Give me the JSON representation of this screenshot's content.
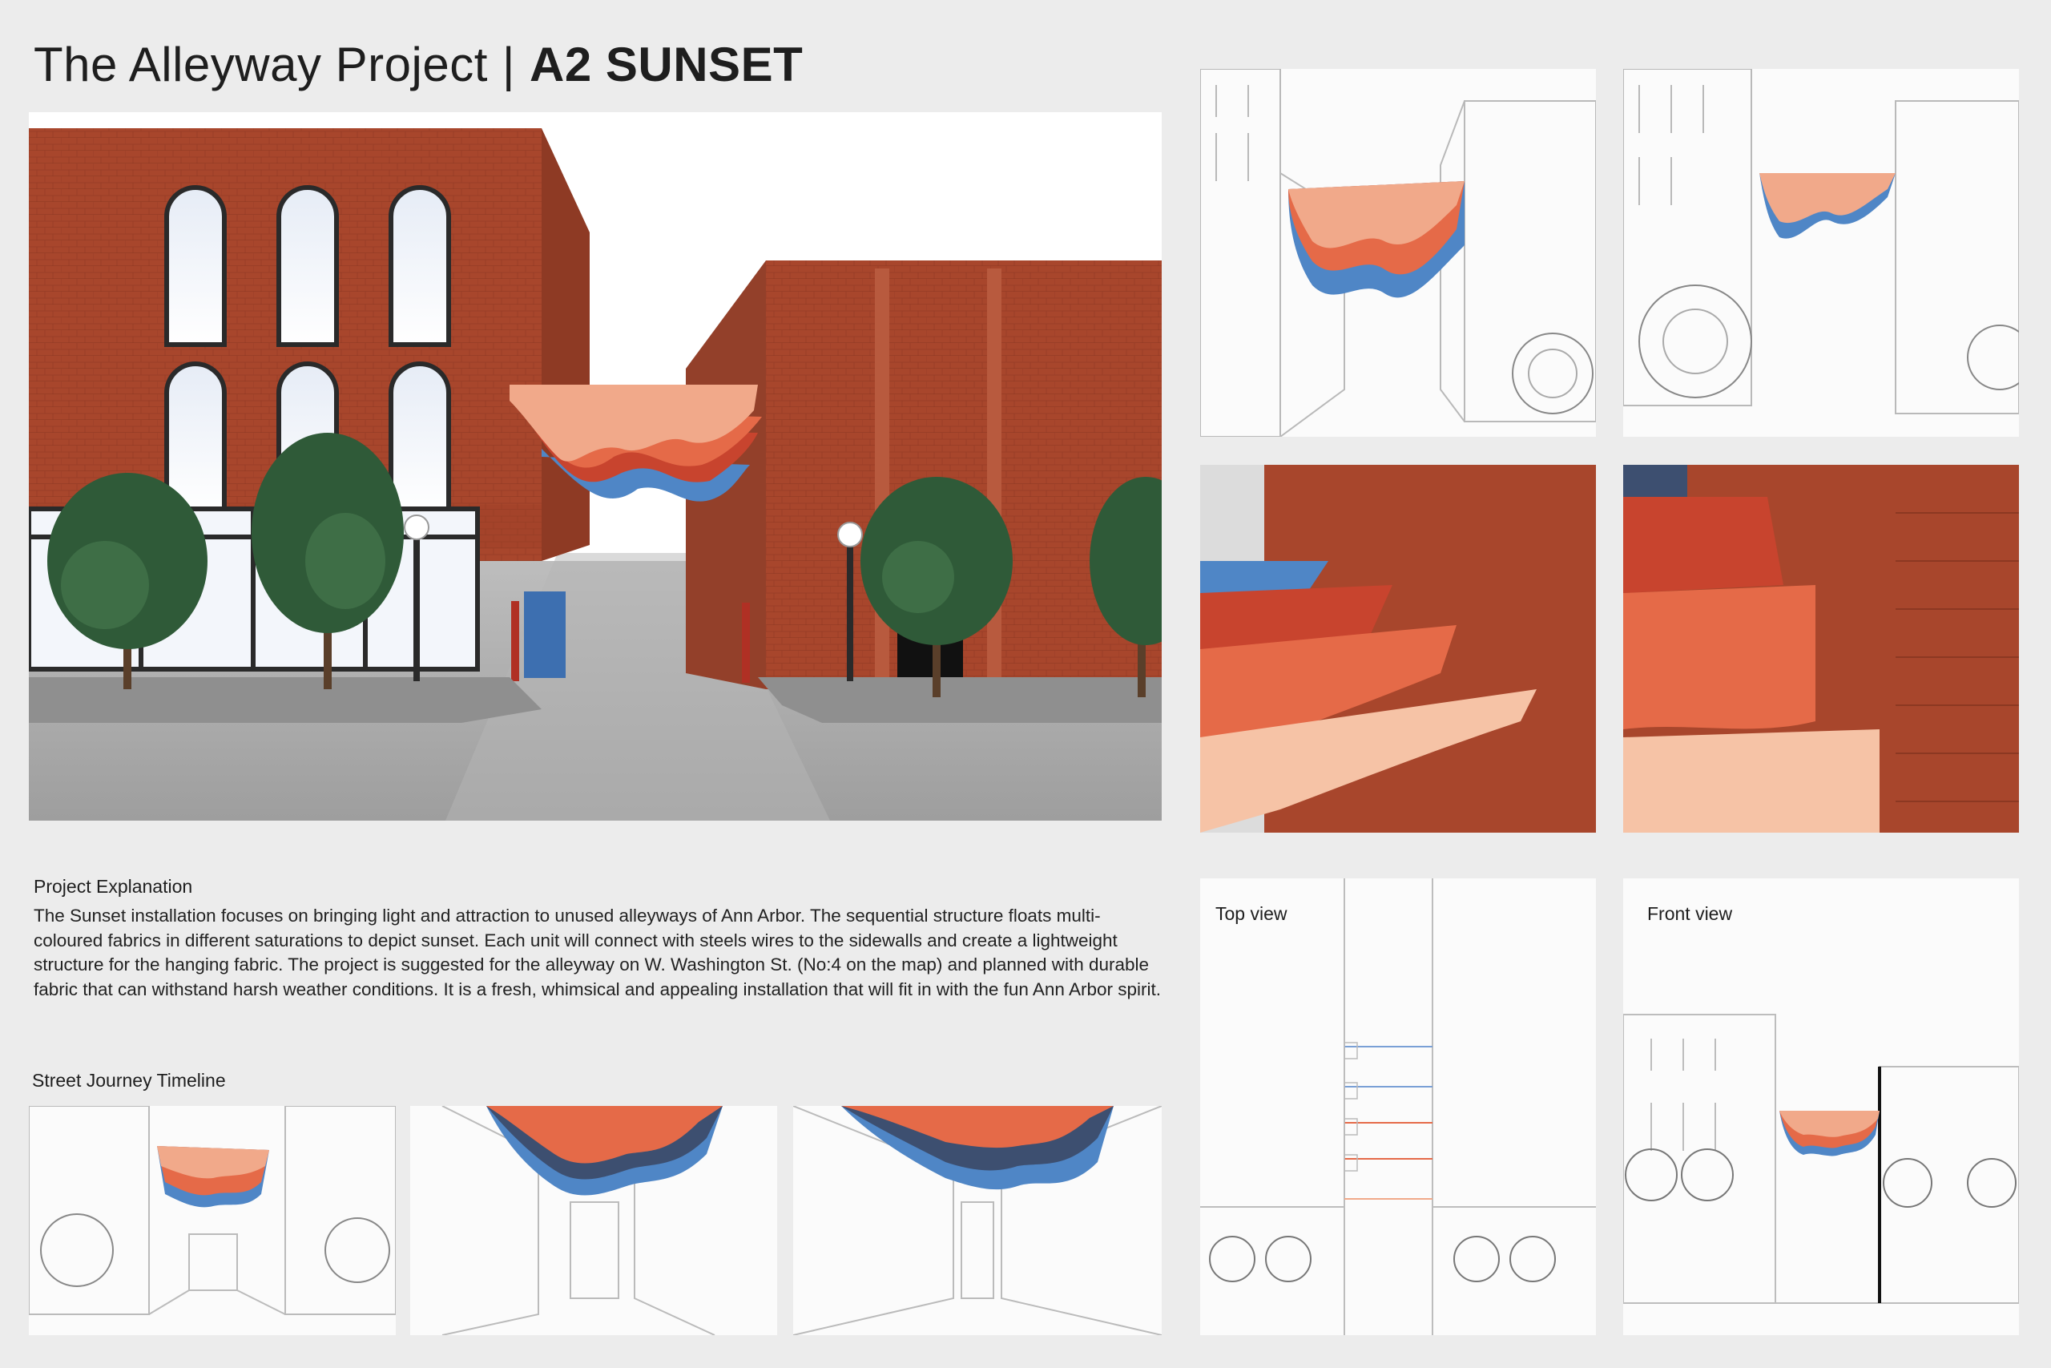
{
  "header": {
    "project": "The Alleyway Project",
    "separator": "|",
    "subtitle": "A2 SUNSET"
  },
  "explanation": {
    "heading": "Project Explanation",
    "body": "The Sunset installation focuses on bringing light and attraction to unused alleyways of Ann Arbor. The sequential structure floats multi-coloured fabrics in different saturations to depict sunset. Each unit will connect with steels wires to the sidewalls and create a lightweight structure for the hanging fabric. The project is suggested for the alleyway on W. Washington St. (No:4 on the map) and planned with durable fabric that can withstand harsh weather conditions. It is a fresh, whimsical and appealing installation that will fit in with the fun Ann Arbor spirit."
  },
  "timeline": {
    "heading": "Street Journey Timeline"
  },
  "views": {
    "top_label": "Top view",
    "front_label": "Front view"
  },
  "colors": {
    "brick": "#a8462c",
    "fabric_peach": "#f1a98a",
    "fabric_coral": "#e56a48",
    "fabric_red": "#c8442e",
    "fabric_blue": "#4f86c6",
    "tree": "#2f5a38"
  }
}
